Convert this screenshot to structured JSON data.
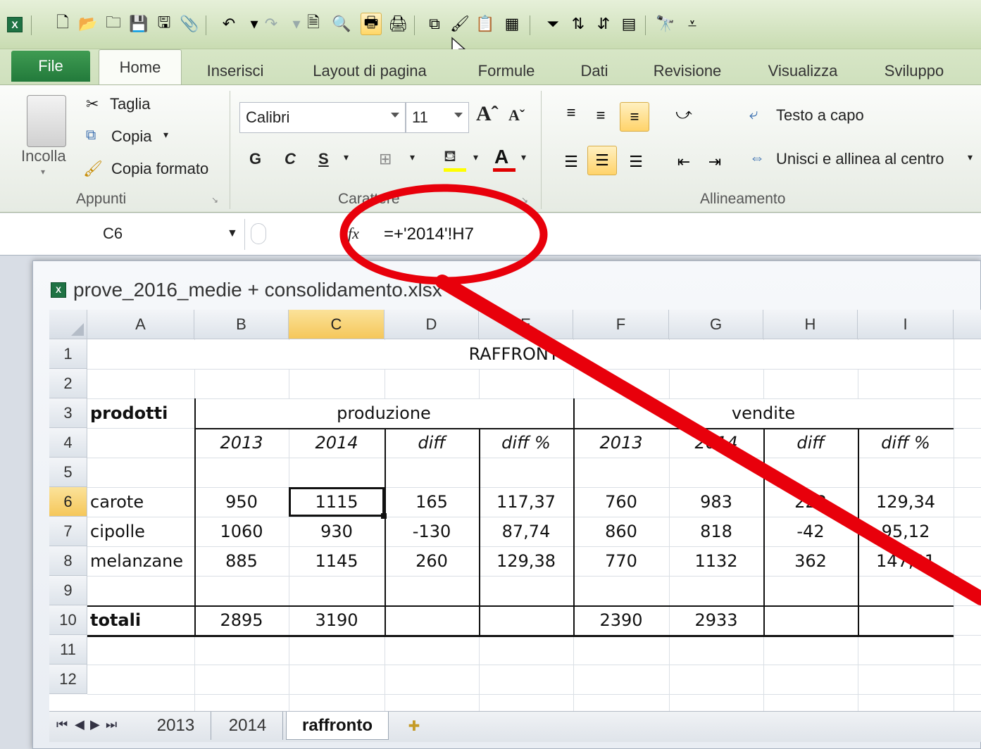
{
  "ribbon_tabs": [
    "File",
    "Home",
    "Inserisci",
    "Layout di pagina",
    "Formule",
    "Dati",
    "Revisione",
    "Visualizza",
    "Sviluppo"
  ],
  "clipboard": {
    "paste_label": "Incolla",
    "cut_label": "Taglia",
    "copy_label": "Copia",
    "format_painter_label": "Copia formato",
    "group_label": "Appunti"
  },
  "font": {
    "font_name": "Calibri",
    "font_size": "11",
    "bold_label": "G",
    "italic_label": "C",
    "underline_label": "S",
    "group_label": "Carattere"
  },
  "alignment": {
    "wrap_text_label": "Testo a capo",
    "merge_center_label": "Unisci e allinea al centro",
    "group_label": "Allineamento"
  },
  "formula_bar": {
    "name_box": "C6",
    "fx_label": "fx",
    "formula": "=+'2014'!H7"
  },
  "workbook": {
    "title": "prove_2016_medie + consolidamento.xlsx"
  },
  "sheet": {
    "columns": [
      "A",
      "B",
      "C",
      "D",
      "E",
      "F",
      "G",
      "H",
      "I"
    ],
    "selected_column": "C",
    "selected_row": "6",
    "rows": [
      "1",
      "2",
      "3",
      "4",
      "5",
      "6",
      "7",
      "8",
      "9",
      "10",
      "11",
      "12"
    ],
    "title": "RAFFRONTO",
    "header_prodotti": "prodotti",
    "header_produzione": "produzione",
    "header_vendite": "vendite",
    "subheaders": [
      "2013",
      "2014",
      "diff",
      "diff %",
      "2013",
      "2014",
      "diff",
      "diff %"
    ],
    "data_rows": [
      {
        "name": "carote",
        "values": [
          "950",
          "1115",
          "165",
          "117,37",
          "760",
          "983",
          "223",
          "129,34"
        ]
      },
      {
        "name": "cipolle",
        "values": [
          "1060",
          "930",
          "-130",
          "87,74",
          "860",
          "818",
          "-42",
          "95,12"
        ]
      },
      {
        "name": "melanzane",
        "values": [
          "885",
          "1145",
          "260",
          "129,38",
          "770",
          "1132",
          "362",
          "147,01"
        ]
      }
    ],
    "totals": {
      "name": "totali",
      "values": [
        "2895",
        "3190",
        "",
        "",
        "2390",
        "2933",
        "",
        ""
      ]
    }
  },
  "sheet_tabs": [
    "2013",
    "2014",
    "raffronto"
  ],
  "active_sheet": "raffronto",
  "colors": {
    "annotation_red": "#e8000b",
    "excel_green": "#1f7244",
    "selection_highlight": "#f5c75a"
  }
}
